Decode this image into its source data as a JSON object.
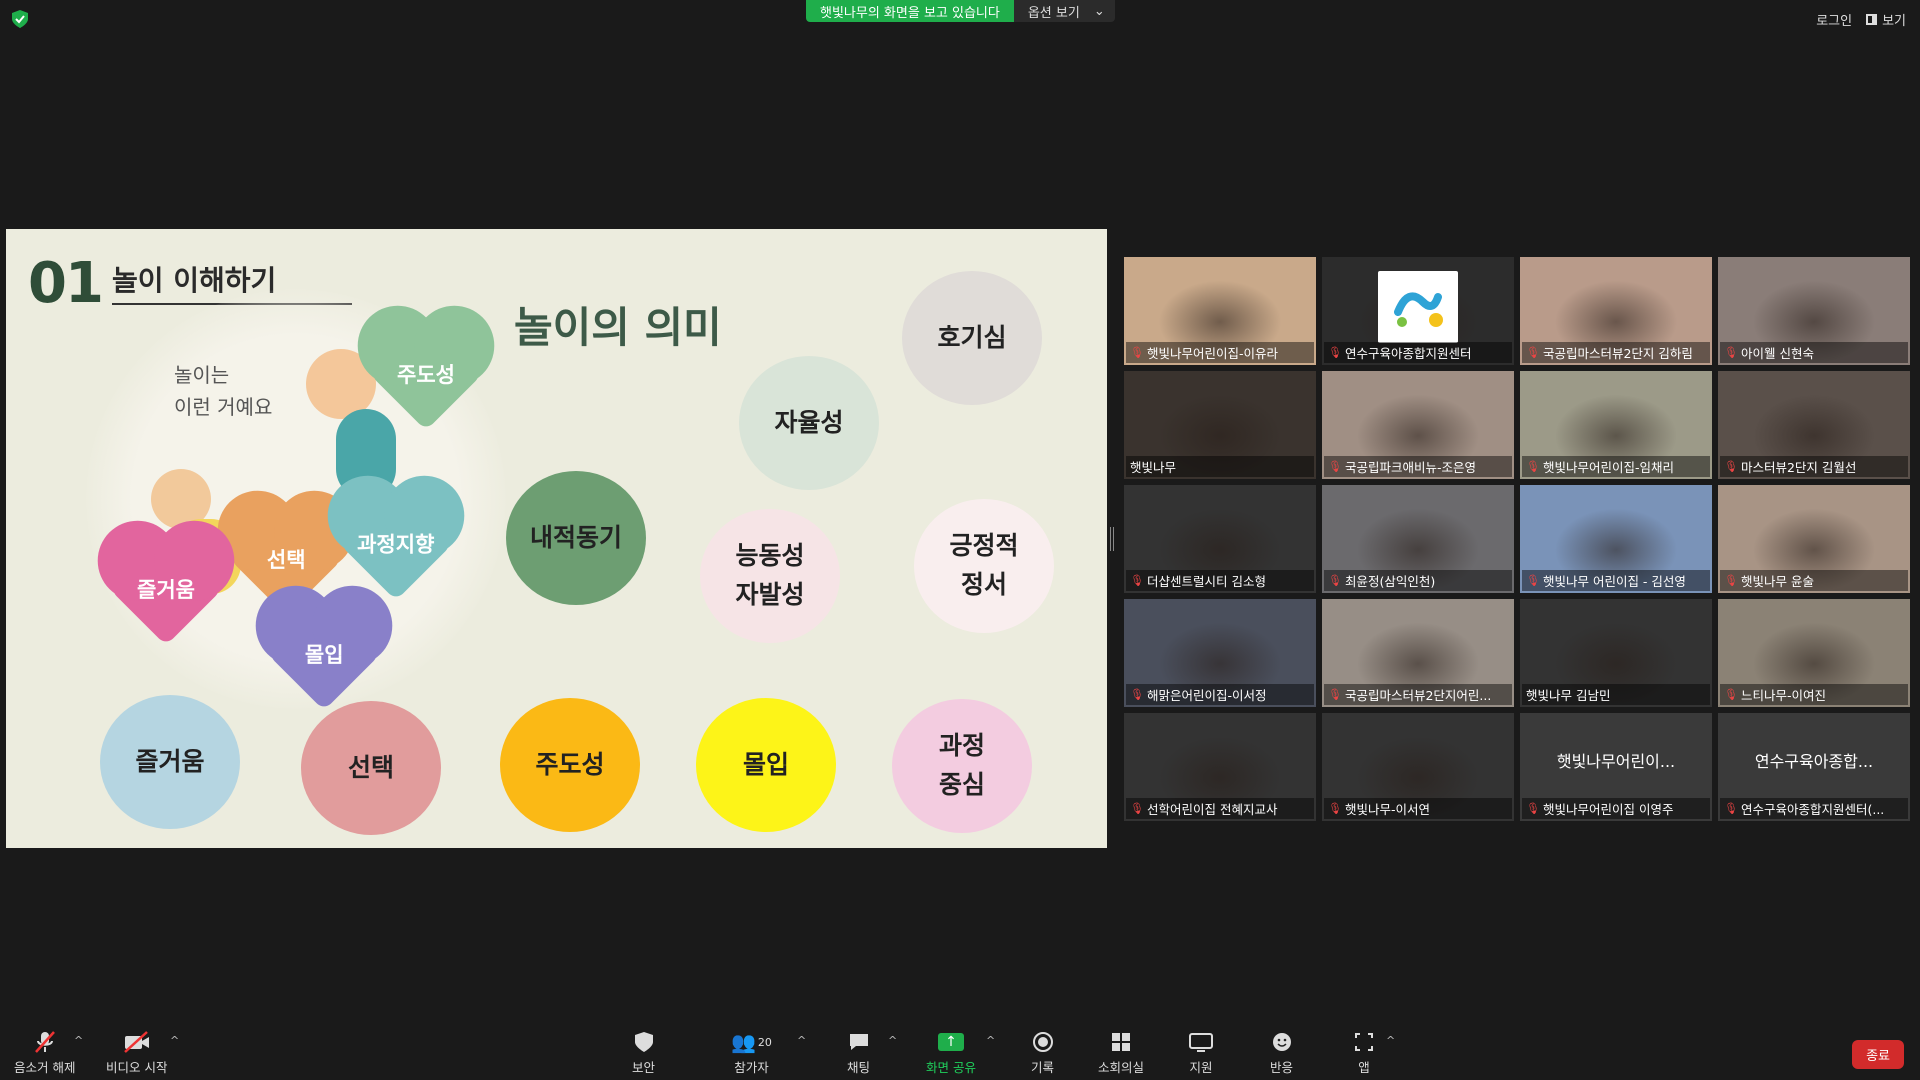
{
  "top_bar": {
    "share_notice": "햇빛나무의 화면을 보고 있습니다",
    "view_options": "옵션 보기",
    "login": "로그인",
    "view": "보기"
  },
  "slide": {
    "number": "01",
    "subtitle": "놀이 이해하기",
    "title": "놀이의 의미",
    "illustration_text": [
      "놀이는",
      "이런 거예요"
    ],
    "hearts": [
      "주도성",
      "선택",
      "과정지향",
      "즐거움",
      "몰입"
    ],
    "circles": [
      {
        "label": "호기심",
        "color": "#e0dcd8"
      },
      {
        "label": "자율성",
        "color": "#d9e4d8"
      },
      {
        "label": "내적동기",
        "color": "#6d9e72"
      },
      {
        "label": "능동성\n자발성",
        "color": "#f6e4e6"
      },
      {
        "label": "긍정적\n정서",
        "color": "#f9eeee"
      },
      {
        "label": "즐거움",
        "color": "#b5d5e1"
      },
      {
        "label": "선택",
        "color": "#e19c9c"
      },
      {
        "label": "주도성",
        "color": "#fbb915"
      },
      {
        "label": "몰입",
        "color": "#fdf418"
      },
      {
        "label": "과정\n중심",
        "color": "#f3cce0"
      }
    ]
  },
  "participants": [
    {
      "name": "햇빛나무어린이집-이유라",
      "muted": true,
      "video": true,
      "bg": "#c9a98a"
    },
    {
      "name": "연수구육아종합지원센터",
      "muted": true,
      "video": true,
      "bg": "#2c2c2c",
      "logo": true
    },
    {
      "name": "국공립마스터뷰2단지 김하림",
      "muted": true,
      "video": true,
      "bg": "#b99b8a"
    },
    {
      "name": "아이웰 신현숙",
      "muted": true,
      "video": true,
      "bg": "#8a7d78"
    },
    {
      "name": "햇빛나무",
      "muted": false,
      "video": true,
      "bg": "#3a332e",
      "active": true
    },
    {
      "name": "국공립파크애비뉴-조은영",
      "muted": true,
      "video": true,
      "bg": "#a08f84"
    },
    {
      "name": "햇빛나무어린이집-임채리",
      "muted": true,
      "video": true,
      "bg": "#9c9a88"
    },
    {
      "name": "마스터뷰2단지 김월선",
      "muted": true,
      "video": true,
      "bg": "#5a504a"
    },
    {
      "name": "더샵센트럴시티 김소형",
      "muted": true,
      "video": true,
      "bg": "#333"
    },
    {
      "name": "최윤정(삼익인천)",
      "muted": true,
      "video": true,
      "bg": "#6b6a6d"
    },
    {
      "name": "햇빛나무 어린이집 - 김선영",
      "muted": true,
      "video": true,
      "bg": "#7a93b8"
    },
    {
      "name": "햇빛나무 윤술",
      "muted": true,
      "video": true,
      "bg": "#a89485"
    },
    {
      "name": "해맑은어린이집-이서정",
      "muted": true,
      "video": true,
      "bg": "#4a4f5c"
    },
    {
      "name": "국공립마스터뷰2단지어린...",
      "muted": true,
      "video": true,
      "bg": "#978e86"
    },
    {
      "name": "햇빛나무 김남민",
      "muted": false,
      "video": true,
      "bg": "#333"
    },
    {
      "name": "느티나무-이여진",
      "muted": true,
      "video": true,
      "bg": "#8b8275"
    },
    {
      "name": "선학어린이집 전혜지교사",
      "muted": true,
      "video": true,
      "bg": "#333"
    },
    {
      "name": "햇빛나무-이서연",
      "muted": true,
      "video": true,
      "bg": "#333"
    },
    {
      "name": "햇빛나무어린이집 이영주",
      "muted": true,
      "video": false,
      "display": "햇빛나무어린이..."
    },
    {
      "name": "연수구육아종합지원센터(...",
      "muted": true,
      "video": false,
      "display": "연수구육아종합..."
    }
  ],
  "toolbar": {
    "mute": "음소거 해제",
    "video": "비디오 시작",
    "security": "보안",
    "participants": "참가자",
    "participant_count": "20",
    "chat": "채팅",
    "share": "화면 공유",
    "record": "기록",
    "breakout": "소회의실",
    "support": "지원",
    "reactions": "반응",
    "apps": "앱",
    "end": "종료"
  },
  "colors": {
    "accent_green": "#1fae4b",
    "end_red": "#d22b2b",
    "active_speaker": "#f0ea4b"
  }
}
